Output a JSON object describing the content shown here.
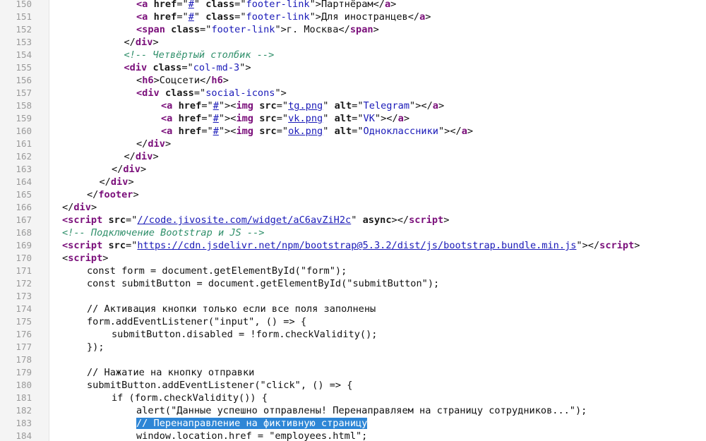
{
  "editor": {
    "lines": [
      {
        "num": "150",
        "indent": 12,
        "tokens": [
          [
            "tag",
            "<a"
          ],
          [
            "text",
            " "
          ],
          [
            "attr",
            "href"
          ],
          [
            "text",
            "=\""
          ],
          [
            "link",
            "#"
          ],
          [
            "text",
            "\" "
          ],
          [
            "attr",
            "class"
          ],
          [
            "text",
            "=\""
          ],
          [
            "str",
            "footer-link"
          ],
          [
            "text",
            "\">Партнёрам</"
          ],
          [
            "tag",
            "a"
          ],
          [
            "text",
            ">"
          ]
        ]
      },
      {
        "num": "151",
        "indent": 12,
        "tokens": [
          [
            "tag",
            "<a"
          ],
          [
            "text",
            " "
          ],
          [
            "attr",
            "href"
          ],
          [
            "text",
            "=\""
          ],
          [
            "link",
            "#"
          ],
          [
            "text",
            "\" "
          ],
          [
            "attr",
            "class"
          ],
          [
            "text",
            "=\""
          ],
          [
            "str",
            "footer-link"
          ],
          [
            "text",
            "\">Для иностранцев</"
          ],
          [
            "tag",
            "a"
          ],
          [
            "text",
            ">"
          ]
        ]
      },
      {
        "num": "152",
        "indent": 12,
        "tokens": [
          [
            "tag",
            "<span"
          ],
          [
            "text",
            " "
          ],
          [
            "attr",
            "class"
          ],
          [
            "text",
            "=\""
          ],
          [
            "str",
            "footer-link"
          ],
          [
            "text",
            "\">г. Москва</"
          ],
          [
            "tag",
            "span"
          ],
          [
            "text",
            ">"
          ]
        ]
      },
      {
        "num": "153",
        "indent": 10,
        "tokens": [
          [
            "text",
            "</"
          ],
          [
            "tag",
            "div"
          ],
          [
            "text",
            ">"
          ]
        ]
      },
      {
        "num": "154",
        "indent": 10,
        "tokens": [
          [
            "comment",
            "<!-- Четвёртый столбик -->"
          ]
        ]
      },
      {
        "num": "155",
        "indent": 10,
        "tokens": [
          [
            "tag",
            "<div"
          ],
          [
            "text",
            " "
          ],
          [
            "attr",
            "class"
          ],
          [
            "text",
            "=\""
          ],
          [
            "str",
            "col-md-3"
          ],
          [
            "text",
            "\">"
          ]
        ]
      },
      {
        "num": "156",
        "indent": 12,
        "tokens": [
          [
            "text",
            "<"
          ],
          [
            "tag",
            "h6"
          ],
          [
            "text",
            ">Соцсети</"
          ],
          [
            "tag",
            "h6"
          ],
          [
            "text",
            ">"
          ]
        ]
      },
      {
        "num": "157",
        "indent": 12,
        "tokens": [
          [
            "tag",
            "<div"
          ],
          [
            "text",
            " "
          ],
          [
            "attr",
            "class"
          ],
          [
            "text",
            "=\""
          ],
          [
            "str",
            "social-icons"
          ],
          [
            "text",
            "\">"
          ]
        ]
      },
      {
        "num": "158",
        "indent": 16,
        "tokens": [
          [
            "tag",
            "<a"
          ],
          [
            "text",
            " "
          ],
          [
            "attr",
            "href"
          ],
          [
            "text",
            "=\""
          ],
          [
            "link",
            "#"
          ],
          [
            "text",
            "\"><"
          ],
          [
            "tag",
            "img"
          ],
          [
            "text",
            " "
          ],
          [
            "attr",
            "src"
          ],
          [
            "text",
            "=\""
          ],
          [
            "link",
            "tg.png"
          ],
          [
            "text",
            "\" "
          ],
          [
            "attr",
            "alt"
          ],
          [
            "text",
            "=\""
          ],
          [
            "str",
            "Telegram"
          ],
          [
            "text",
            "\"></"
          ],
          [
            "tag",
            "a"
          ],
          [
            "text",
            ">"
          ]
        ]
      },
      {
        "num": "159",
        "indent": 16,
        "tokens": [
          [
            "tag",
            "<a"
          ],
          [
            "text",
            " "
          ],
          [
            "attr",
            "href"
          ],
          [
            "text",
            "=\""
          ],
          [
            "link",
            "#"
          ],
          [
            "text",
            "\"><"
          ],
          [
            "tag",
            "img"
          ],
          [
            "text",
            " "
          ],
          [
            "attr",
            "src"
          ],
          [
            "text",
            "=\""
          ],
          [
            "link",
            "vk.png"
          ],
          [
            "text",
            "\" "
          ],
          [
            "attr",
            "alt"
          ],
          [
            "text",
            "=\""
          ],
          [
            "str",
            "VK"
          ],
          [
            "text",
            "\"></"
          ],
          [
            "tag",
            "a"
          ],
          [
            "text",
            ">"
          ]
        ]
      },
      {
        "num": "160",
        "indent": 16,
        "tokens": [
          [
            "tag",
            "<a"
          ],
          [
            "text",
            " "
          ],
          [
            "attr",
            "href"
          ],
          [
            "text",
            "=\""
          ],
          [
            "link",
            "#"
          ],
          [
            "text",
            "\"><"
          ],
          [
            "tag",
            "img"
          ],
          [
            "text",
            " "
          ],
          [
            "attr",
            "src"
          ],
          [
            "text",
            "=\""
          ],
          [
            "link",
            "ok.png"
          ],
          [
            "text",
            "\" "
          ],
          [
            "attr",
            "alt"
          ],
          [
            "text",
            "=\""
          ],
          [
            "str",
            "Одноклассники"
          ],
          [
            "text",
            "\"></"
          ],
          [
            "tag",
            "a"
          ],
          [
            "text",
            ">"
          ]
        ]
      },
      {
        "num": "161",
        "indent": 12,
        "tokens": [
          [
            "text",
            "</"
          ],
          [
            "tag",
            "div"
          ],
          [
            "text",
            ">"
          ]
        ]
      },
      {
        "num": "162",
        "indent": 10,
        "tokens": [
          [
            "text",
            "</"
          ],
          [
            "tag",
            "div"
          ],
          [
            "text",
            ">"
          ]
        ]
      },
      {
        "num": "163",
        "indent": 8,
        "tokens": [
          [
            "text",
            "</"
          ],
          [
            "tag",
            "div"
          ],
          [
            "text",
            ">"
          ]
        ]
      },
      {
        "num": "164",
        "indent": 6,
        "tokens": [
          [
            "text",
            "</"
          ],
          [
            "tag",
            "div"
          ],
          [
            "text",
            ">"
          ]
        ]
      },
      {
        "num": "165",
        "indent": 4,
        "tokens": [
          [
            "text",
            "</"
          ],
          [
            "tag",
            "footer"
          ],
          [
            "text",
            ">"
          ]
        ]
      },
      {
        "num": "166",
        "indent": 0,
        "tokens": [
          [
            "text",
            "</"
          ],
          [
            "tag",
            "div"
          ],
          [
            "text",
            ">"
          ]
        ]
      },
      {
        "num": "167",
        "indent": 0,
        "tokens": [
          [
            "tag",
            "<script"
          ],
          [
            "text",
            " "
          ],
          [
            "attr",
            "src"
          ],
          [
            "text",
            "=\""
          ],
          [
            "link",
            "//code.jivosite.com/widget/aC6avZiH2c"
          ],
          [
            "text",
            "\" "
          ],
          [
            "attr",
            "async"
          ],
          [
            "text",
            "></"
          ],
          [
            "tag",
            "script"
          ],
          [
            "text",
            ">"
          ]
        ]
      },
      {
        "num": "168",
        "indent": 0,
        "tokens": [
          [
            "comment",
            "<!-- Подключение Bootstrap и JS -->"
          ]
        ]
      },
      {
        "num": "169",
        "indent": 0,
        "tokens": [
          [
            "tag",
            "<script"
          ],
          [
            "text",
            " "
          ],
          [
            "attr",
            "src"
          ],
          [
            "text",
            "=\""
          ],
          [
            "link",
            "https://cdn.jsdelivr.net/npm/bootstrap@5.3.2/dist/js/bootstrap.bundle.min.js"
          ],
          [
            "text",
            "\"></"
          ],
          [
            "tag",
            "script"
          ],
          [
            "text",
            ">"
          ]
        ]
      },
      {
        "num": "170",
        "indent": 0,
        "tokens": [
          [
            "text",
            "<"
          ],
          [
            "tag",
            "script"
          ],
          [
            "text",
            ">"
          ]
        ]
      },
      {
        "num": "171",
        "indent": 4,
        "tokens": [
          [
            "text",
            "const form = document.getElementById(\"form\");"
          ]
        ]
      },
      {
        "num": "172",
        "indent": 4,
        "tokens": [
          [
            "text",
            "const submitButton = document.getElementById(\"submitButton\");"
          ]
        ]
      },
      {
        "num": "173",
        "indent": 0,
        "tokens": []
      },
      {
        "num": "174",
        "indent": 4,
        "tokens": [
          [
            "text",
            "// Активация кнопки только если все поля заполнены"
          ]
        ]
      },
      {
        "num": "175",
        "indent": 4,
        "tokens": [
          [
            "text",
            "form.addEventListener(\"input\", () => {"
          ]
        ]
      },
      {
        "num": "176",
        "indent": 8,
        "tokens": [
          [
            "text",
            "submitButton.disabled = !form.checkValidity();"
          ]
        ]
      },
      {
        "num": "177",
        "indent": 4,
        "tokens": [
          [
            "text",
            "});"
          ]
        ]
      },
      {
        "num": "178",
        "indent": 0,
        "tokens": []
      },
      {
        "num": "179",
        "indent": 4,
        "tokens": [
          [
            "text",
            "// Нажатие на кнопку отправки"
          ]
        ]
      },
      {
        "num": "180",
        "indent": 4,
        "tokens": [
          [
            "text",
            "submitButton.addEventListener(\"click\", () => {"
          ]
        ]
      },
      {
        "num": "181",
        "indent": 8,
        "tokens": [
          [
            "text",
            "if (form.checkValidity()) {"
          ]
        ]
      },
      {
        "num": "182",
        "indent": 12,
        "tokens": [
          [
            "text",
            "alert(\"Данные успешно отправлены! Перенаправляем на страницу сотрудников...\");"
          ]
        ]
      },
      {
        "num": "183",
        "indent": 12,
        "tokens": [
          [
            "sel",
            "// Перенаправление на фиктивную страницу"
          ]
        ]
      },
      {
        "num": "184",
        "indent": 12,
        "tokens": [
          [
            "text",
            "window.location.href = \"employees.html\";"
          ]
        ]
      }
    ]
  }
}
